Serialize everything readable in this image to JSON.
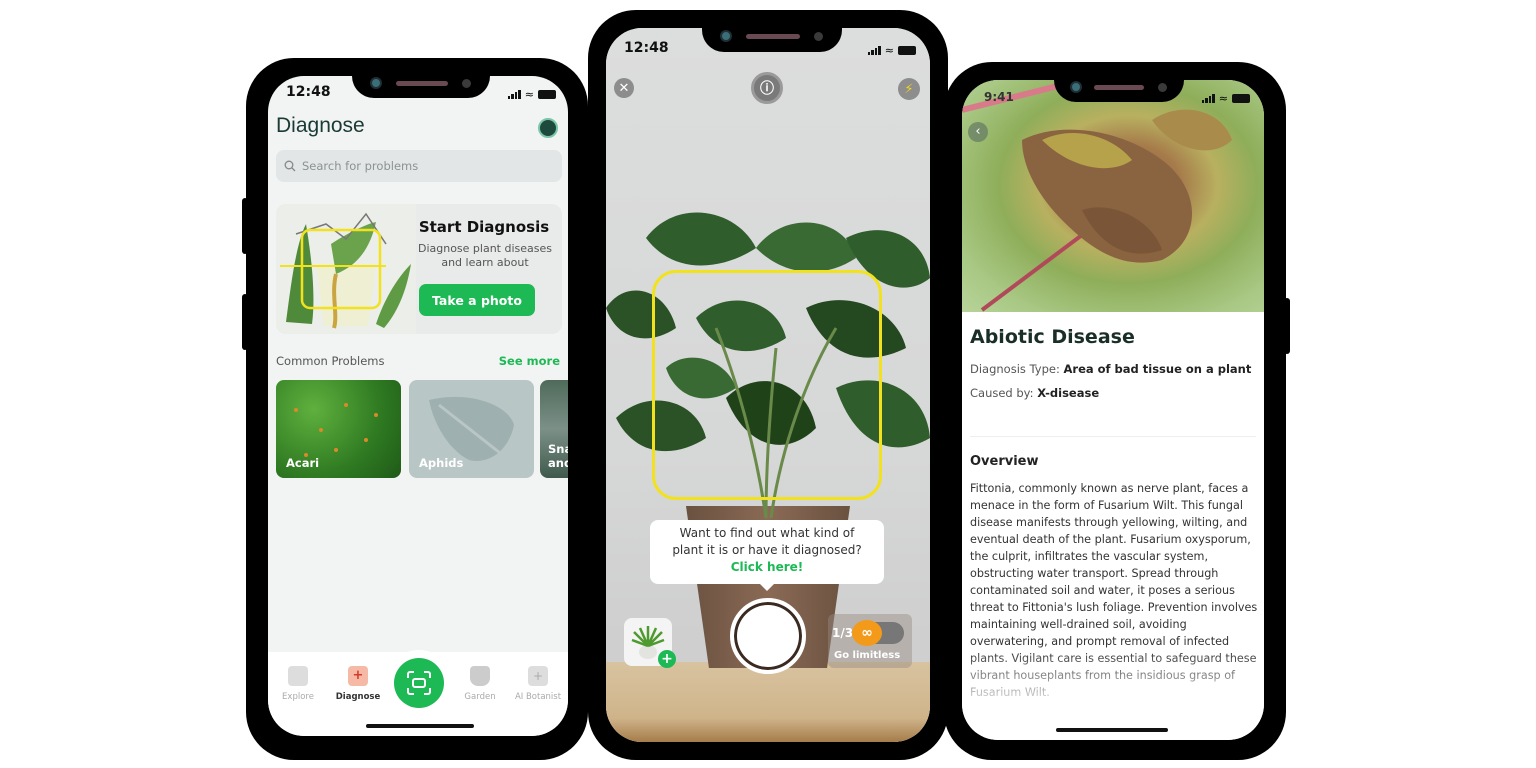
{
  "phone_diagnose": {
    "status_time": "12:48",
    "title": "Diagnose",
    "search_placeholder": "Search for problems",
    "start_card": {
      "title": "Start Diagnosis",
      "subtitle_line1": "Diagnose plant diseases",
      "subtitle_line2": "and learn about",
      "button": "Take a photo"
    },
    "common_problems": {
      "heading": "Common Problems",
      "see_more": "See more",
      "items": [
        {
          "label": "Acari"
        },
        {
          "label": "Aphids"
        },
        {
          "label": "Sna… and"
        }
      ]
    },
    "tabs": [
      {
        "label": "Explore",
        "icon": "explore-icon"
      },
      {
        "label": "Diagnose",
        "icon": "diagnose-shield-icon",
        "active": true
      },
      {
        "label": "",
        "icon": "scan-icon"
      },
      {
        "label": "Garden",
        "icon": "garden-pot-icon"
      },
      {
        "label": "AI Botanist",
        "icon": "ai-botanist-icon"
      }
    ],
    "accent_color": "#1db954"
  },
  "phone_camera": {
    "status_time": "12:48",
    "tooltip": {
      "line1": "Want to find out what kind of",
      "line2": "plant it is or have it diagnosed?",
      "link": "Click here!"
    },
    "scan_count": "1/3",
    "go_limitless": "Go limitless",
    "frame_color": "#f2e21e",
    "limitless_color": "#f39a1b"
  },
  "phone_detail": {
    "status_time": "9:41",
    "title": "Abiotic Disease",
    "diagnosis_type_label": "Diagnosis Type:",
    "diagnosis_type_value": "Area of bad tissue on a plant",
    "caused_by_label": "Caused by:",
    "caused_by_value": "X-disease",
    "overview_heading": "Overview",
    "overview_text": "Fittonia, commonly known as nerve plant, faces a menace in the form of Fusarium Wilt. This fungal disease manifests through yellowing, wilting, and eventual death of the plant. Fusarium oxysporum, the culprit, infiltrates the vascular system, obstructing water transport. Spread through contaminated soil and water, it poses a serious threat to Fittonia's lush foliage. Prevention involves maintaining well-drained soil, avoiding overwatering, and prompt removal of infected plants. Vigilant care is essential to safeguard these vibrant houseplants from the insidious grasp of Fusarium Wilt."
  }
}
